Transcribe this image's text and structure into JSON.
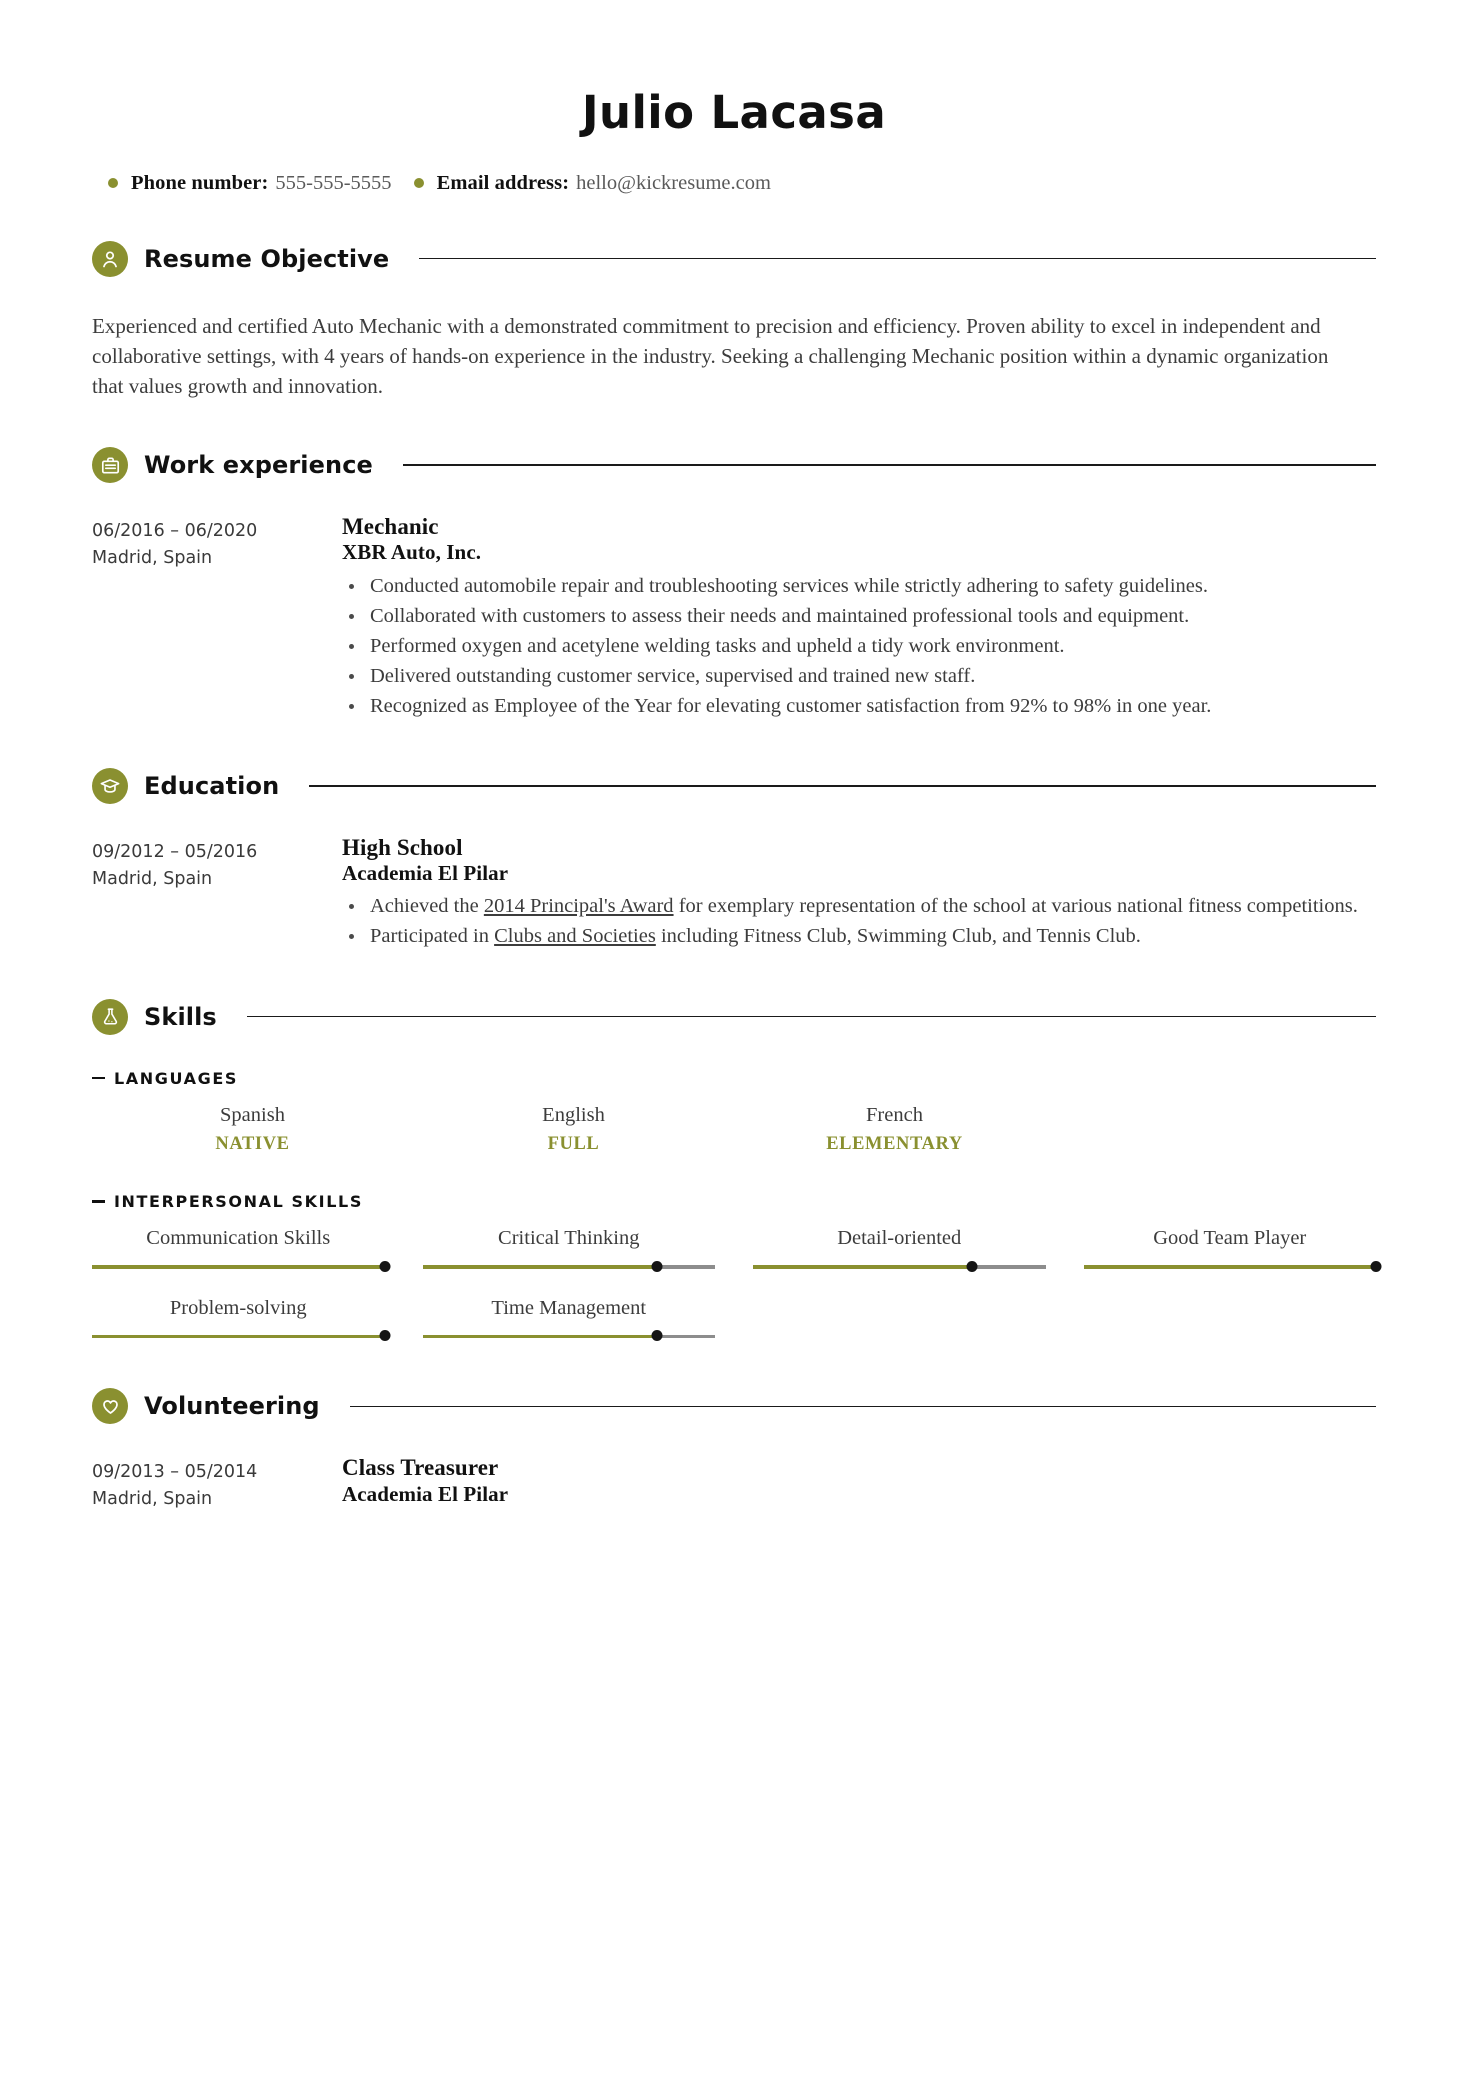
{
  "header": {
    "name": "Julio Lacasa",
    "contacts": [
      {
        "icon": "bullet-dot-icon",
        "label": "Phone number:",
        "value": "555-555-5555"
      },
      {
        "icon": "bullet-dot-icon",
        "label": "Email address:",
        "value": "hello@kickresume.com"
      }
    ]
  },
  "colors": {
    "accent": "#8a9030",
    "rule": "#1a1a1a",
    "body_text": "#3c3c3c",
    "heading_text": "#111111",
    "track": "#8d8d8d",
    "knob": "#151515"
  },
  "sections": {
    "objective": {
      "title": "Resume Objective",
      "icon": "person-icon",
      "body": "Experienced and certified Auto Mechanic with a demonstrated commitment to precision and efficiency. Proven ability to excel in independent and collaborative settings, with 4 years of hands-on experience in the industry. Seeking a challenging Mechanic position within a dynamic organization that values growth and innovation."
    },
    "work": {
      "title": "Work experience",
      "icon": "briefcase-icon",
      "entries": [
        {
          "dates": "06/2016 – 06/2020",
          "location": "Madrid, Spain",
          "title": "Mechanic",
          "org": "XBR Auto, Inc.",
          "bullets": [
            "Conducted automobile repair and troubleshooting services while strictly adhering to safety guidelines.",
            "Collaborated with customers to assess their needs and maintained professional tools and equipment.",
            "Performed oxygen and acetylene welding tasks and upheld a tidy work environment.",
            "Delivered outstanding customer service, supervised and trained new staff.",
            "Recognized as Employee of the Year for elevating customer satisfaction from 92% to 98% in one year."
          ]
        }
      ]
    },
    "education": {
      "title": "Education",
      "icon": "graduation-cap-icon",
      "entries": [
        {
          "dates": "09/2012 – 05/2016",
          "location": "Madrid, Spain",
          "title": "High School",
          "org": "Academia El Pilar",
          "bullets_html": [
            "Achieved the <span class=\"u\">2014 Principal's Award</span> for exemplary representation of the school at various national fitness competitions.",
            "Participated in <span class=\"u\">Clubs and Societies</span> including Fitness Club, Swimming Club, and Tennis Club."
          ]
        }
      ]
    },
    "skills": {
      "title": "Skills",
      "icon": "flask-icon",
      "languages": {
        "subtitle": "LANGUAGES",
        "items": [
          {
            "name": "Spanish",
            "level": "NATIVE"
          },
          {
            "name": "English",
            "level": "FULL"
          },
          {
            "name": "French",
            "level": "ELEMENTARY"
          }
        ]
      },
      "interpersonal": {
        "subtitle": "INTERPERSONAL SKILLS",
        "items": [
          {
            "name": "Communication Skills",
            "value": 100
          },
          {
            "name": "Critical Thinking",
            "value": 80
          },
          {
            "name": "Detail-oriented",
            "value": 75
          },
          {
            "name": "Good Team Player",
            "value": 100
          },
          {
            "name": "Problem-solving",
            "value": 100
          },
          {
            "name": "Time Management",
            "value": 80
          }
        ]
      }
    },
    "volunteering": {
      "title": "Volunteering",
      "icon": "heart-icon",
      "entries": [
        {
          "dates": "09/2013 – 05/2014",
          "location": "Madrid, Spain",
          "title": "Class Treasurer",
          "org": "Academia El Pilar"
        }
      ]
    }
  }
}
